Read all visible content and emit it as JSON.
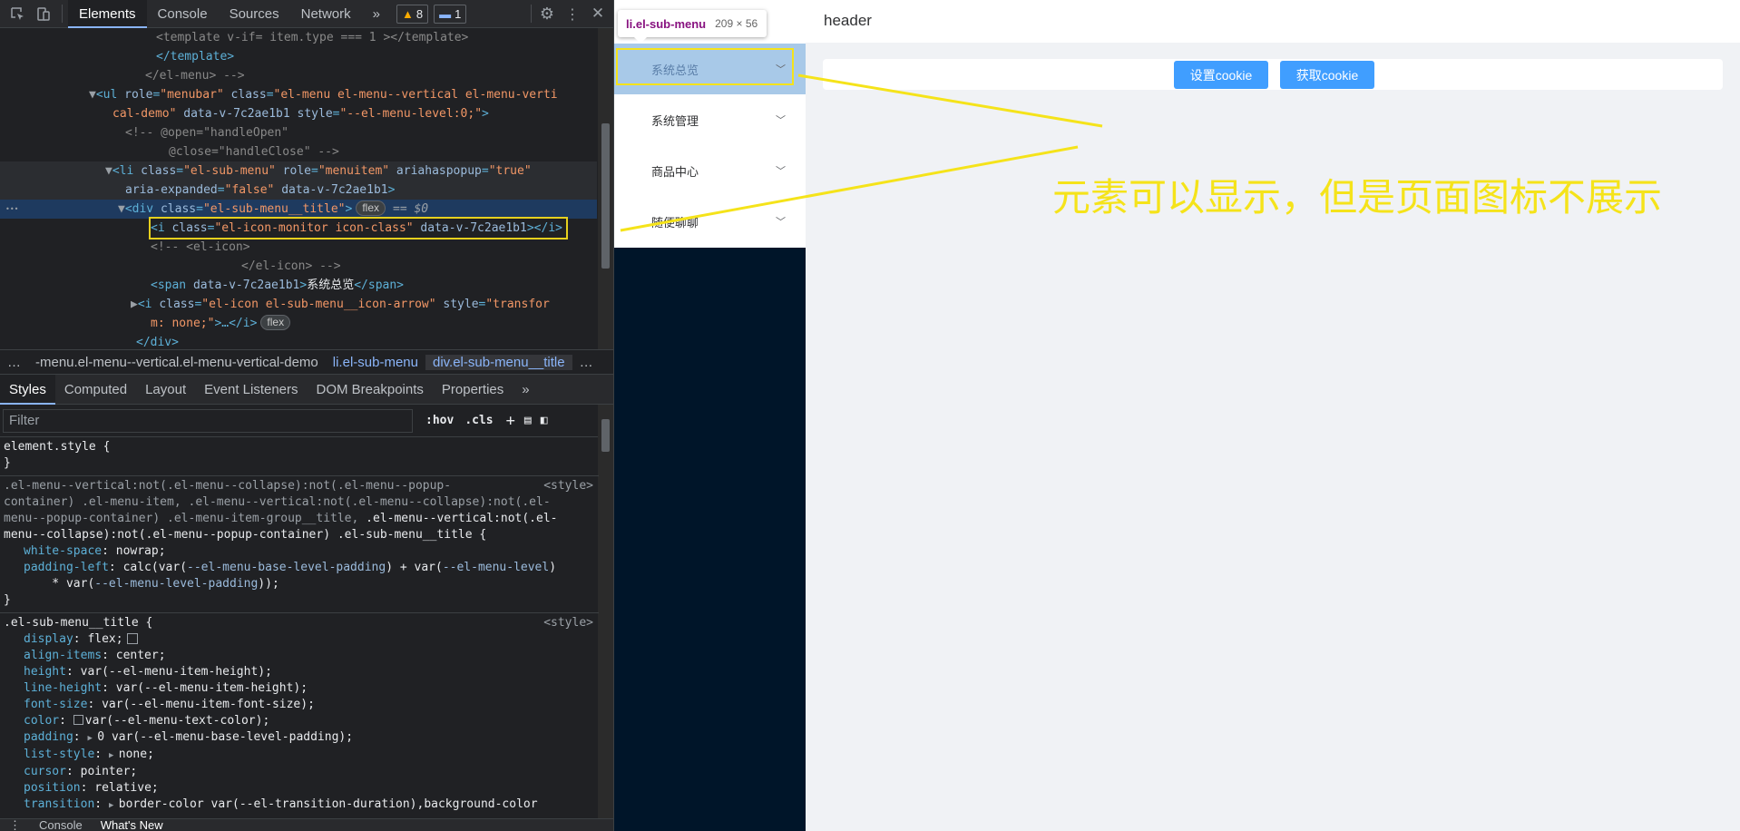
{
  "devtools": {
    "tabs": [
      "Elements",
      "Console",
      "Sources",
      "Network"
    ],
    "more": "»",
    "warn_count": "8",
    "msg_count": "1",
    "code_lines": [
      {
        "segs": [
          [
            "cm",
            "<template v-if= item.type === 1 ></template>"
          ]
        ]
      },
      {
        "segs": [
          [
            "tg",
            "</template>"
          ]
        ]
      },
      {
        "segs": [
          [
            "cm",
            "</el-menu> -->"
          ]
        ]
      },
      {
        "segs": [
          [
            "arrow",
            "▼"
          ],
          [
            "tg",
            "<ul "
          ],
          [
            "at",
            "role"
          ],
          [
            "tg",
            "="
          ],
          [
            "av",
            "\"menubar\""
          ],
          [
            "at",
            " class"
          ],
          [
            "tg",
            "="
          ],
          [
            "av",
            "\"el-menu el-menu--vertical el-menu-verti"
          ]
        ]
      },
      {
        "segs": [
          [
            "av",
            "cal-demo\""
          ],
          [
            "at",
            " data-v-7c2ae1b1"
          ],
          [
            "at",
            " style"
          ],
          [
            "tg",
            "="
          ],
          [
            "av",
            "\"--el-menu-level:0;\""
          ],
          [
            "tg",
            ">"
          ]
        ]
      },
      {
        "segs": [
          [
            "cm",
            "<!-- @open=\"handleOpen\""
          ]
        ]
      },
      {
        "segs": [
          [
            "cm",
            "@close=\"handleClose\" -->"
          ]
        ]
      },
      {
        "segs": [
          [
            "arrow",
            "▼"
          ],
          [
            "tg",
            "<li "
          ],
          [
            "at",
            "class"
          ],
          [
            "tg",
            "="
          ],
          [
            "av",
            "\"el-sub-menu\""
          ],
          [
            "at",
            " role"
          ],
          [
            "tg",
            "="
          ],
          [
            "av",
            "\"menuitem\""
          ],
          [
            "at",
            " ariahaspopup"
          ],
          [
            "tg",
            "="
          ],
          [
            "av",
            "\"true\""
          ]
        ]
      },
      {
        "segs": [
          [
            "at",
            "aria-expanded"
          ],
          [
            "tg",
            "="
          ],
          [
            "av",
            "\"false\""
          ],
          [
            "at",
            " data-v-7c2ae1b1"
          ],
          [
            "tg",
            ">"
          ]
        ]
      },
      {
        "segs": [
          [
            "arrow",
            "▼"
          ],
          [
            "tg",
            "<div "
          ],
          [
            "at",
            "class"
          ],
          [
            "tg",
            "="
          ],
          [
            "av",
            "\"el-sub-menu__title\""
          ],
          [
            "tg",
            ">"
          ]
        ]
      },
      {
        "segs": [
          [
            "tg",
            "<i "
          ],
          [
            "at",
            "class"
          ],
          [
            "tg",
            "="
          ],
          [
            "av",
            "\"el-icon-monitor icon-class\""
          ],
          [
            "at",
            " data-v-7c2ae1b1"
          ],
          [
            "tg",
            "></i>"
          ]
        ]
      },
      {
        "segs": [
          [
            "cm",
            "<!-- <el-icon>"
          ]
        ]
      },
      {
        "segs": [
          [
            "cm",
            "</el-icon> -->"
          ]
        ]
      },
      {
        "segs": [
          [
            "tg",
            "<span "
          ],
          [
            "at",
            "data-v-7c2ae1b1"
          ],
          [
            "tg",
            ">"
          ],
          [
            "tx",
            "系统总览"
          ],
          [
            "tg",
            "</span>"
          ]
        ]
      },
      {
        "segs": [
          [
            "arrow",
            "▶"
          ],
          [
            "tg",
            "<i "
          ],
          [
            "at",
            "class"
          ],
          [
            "tg",
            "="
          ],
          [
            "av",
            "\"el-icon el-sub-menu__icon-arrow\""
          ],
          [
            "at",
            " style"
          ],
          [
            "tg",
            "="
          ],
          [
            "av",
            "\"transfor"
          ]
        ]
      },
      {
        "segs": [
          [
            "av",
            "m: none;\""
          ],
          [
            "tg",
            ">…</i>"
          ]
        ]
      },
      {
        "segs": [
          [
            "tg",
            "</div>"
          ]
        ]
      }
    ],
    "flex_pill": "flex",
    "eq_sel": "== $0",
    "breadcrumb": [
      "…",
      "-menu.el-menu--vertical.el-menu-vertical-demo",
      "li.el-sub-menu",
      "div.el-sub-menu__title",
      "…"
    ],
    "style_tabs": [
      "Styles",
      "Computed",
      "Layout",
      "Event Listeners",
      "DOM Breakpoints",
      "Properties",
      "»"
    ],
    "filter_placeholder": "Filter",
    "hov": ":hov",
    "cls": ".cls",
    "styles": {
      "element_style": "element.style {",
      "close": "}",
      "rule1_sel_1": ".el-menu--vertical:not(.el-menu--collapse):not(.el-menu--popup-",
      "rule1_sel_2": "container) .el-menu-item, .el-menu--vertical:not(.el-menu--collapse):not(.el-",
      "rule1_sel_3": "menu--popup-container) .el-menu-item-group__title, ",
      "rule1_sel_3b": ".el-menu--vertical:not(.el-",
      "rule1_sel_4": "menu--collapse):not(.el-menu--popup-container) .el-sub-menu__title {",
      "src": "<style>",
      "r1_d1_n": "white-space",
      "r1_d1_v": "nowrap;",
      "r1_d2_n": "padding-left",
      "r1_d2_v1": "calc(var(",
      "r1_d2_var1": "--el-menu-base-level-padding",
      "r1_d2_v2": ") + var(",
      "r1_d2_var2": "--el-menu-level",
      "r1_d2_v3": ")",
      "r1_d2_v4": "    * var(",
      "r1_d2_var3": "--el-menu-level-padding",
      "r1_d2_v5": "));",
      "rule2_sel": ".el-sub-menu__title {",
      "decls": [
        [
          "display",
          "flex;"
        ],
        [
          "align-items",
          "center;"
        ],
        [
          "height",
          "var(--el-menu-item-height);"
        ],
        [
          "line-height",
          "var(--el-menu-item-height);"
        ],
        [
          "font-size",
          "var(--el-menu-item-font-size);"
        ],
        [
          "color",
          "var(--el-menu-text-color);"
        ],
        [
          "padding",
          "0 var(--el-menu-base-level-padding);"
        ],
        [
          "list-style",
          "none;"
        ],
        [
          "cursor",
          "pointer;"
        ],
        [
          "position",
          "relative;"
        ],
        [
          "transition",
          "border-color var(--el-transition-duration),background-color"
        ]
      ]
    },
    "drawer_tabs": [
      "Console",
      "What's New"
    ]
  },
  "page": {
    "header": "header",
    "menu_items": [
      "系统总览",
      "系统管理",
      "商品中心",
      "随便聊聊"
    ],
    "btn_set": "设置cookie",
    "btn_get": "获取cookie",
    "tooltip_name": "li.el-sub-menu",
    "tooltip_dims": "209 × 56",
    "annotation": "元素可以显示，但是页面图标不展示"
  },
  "colors": {
    "accent": "#409eff",
    "annotation": "#f5e31a",
    "sidebar": "#001529"
  }
}
